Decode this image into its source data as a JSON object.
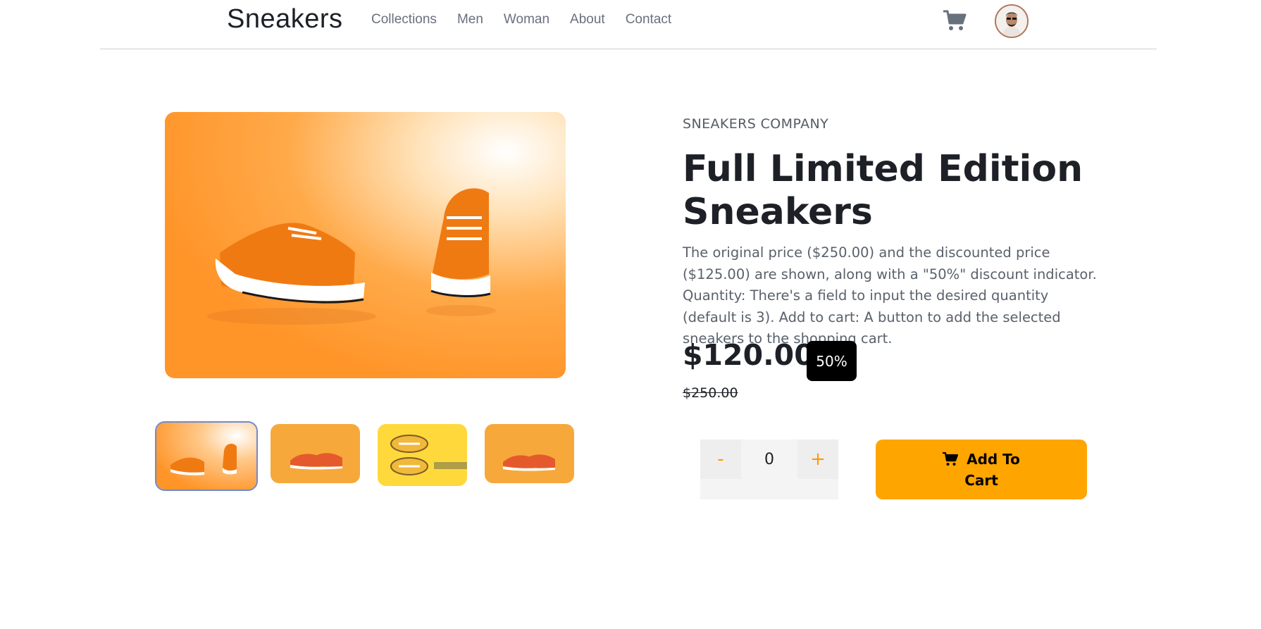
{
  "header": {
    "logo": "Sneakers",
    "nav": [
      "Collections",
      "Men",
      "Woman",
      "About",
      "Contact"
    ],
    "cart_icon": "cart-icon",
    "avatar_icon": "user-avatar"
  },
  "gallery": {
    "main_image": "orange sneakers on orange background",
    "thumbnails": [
      "thumbnail-1",
      "thumbnail-2",
      "thumbnail-3",
      "thumbnail-4"
    ],
    "active_thumbnail": 0
  },
  "product": {
    "company": "SNEAKERS COMPANY",
    "title": "Full Limited Edition Sneakers",
    "description": "The original price ($250.00) and the discounted price ($125.00) are shown, along with a \"50%\" discount indicator. Quantity: There's a field to input the desired quantity (default is 3). Add to cart: A button to add the selected sneakers to the shopping cart.",
    "price": "$120.00",
    "discount": "50%",
    "original_price": "$250.00"
  },
  "cart_controls": {
    "minus": "-",
    "quantity": "0",
    "plus": "+",
    "add_to_cart_line1": "Add To",
    "add_to_cart_line2": "Cart"
  },
  "colors": {
    "accent": "#ffa500",
    "text": "#1d2026",
    "muted": "#69707d",
    "badge": "#000000"
  }
}
